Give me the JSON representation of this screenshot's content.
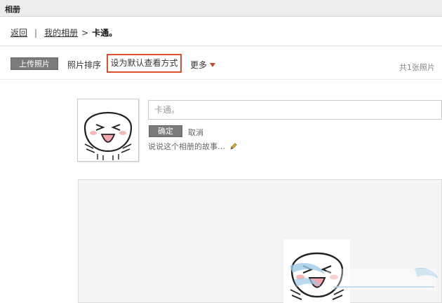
{
  "window": {
    "title": "相册"
  },
  "breadcrumb": {
    "back": "返回",
    "separator": "|",
    "my_albums": "我的相册",
    "arrow": ">",
    "current": "卡通。"
  },
  "toolbar": {
    "upload_label": "上传照片",
    "sort_label": "照片排序",
    "default_view_label": "设为默认查看方式",
    "more_label": "更多",
    "photo_count": "共1张照片"
  },
  "album": {
    "title_value": "卡通。",
    "confirm_label": "确定",
    "cancel_label": "取消",
    "story_placeholder": "说说这个相册的故事…"
  },
  "colors": {
    "highlight_border": "#d9502a",
    "button_bg": "#7b7b7b"
  },
  "icons": {
    "edit": "pencil-icon",
    "more": "caret-down-icon"
  }
}
